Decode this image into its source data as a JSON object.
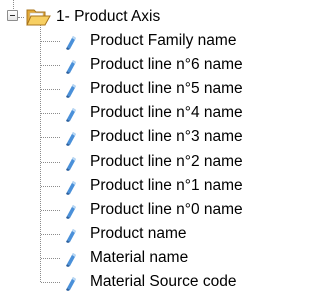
{
  "tree": {
    "root": {
      "label": "1- Product Axis",
      "icon": "folder-open-icon",
      "expanded": true
    },
    "children": [
      {
        "label": "Product Family name",
        "icon": "leaf-icon"
      },
      {
        "label": "Product line n°6 name",
        "icon": "leaf-icon"
      },
      {
        "label": "Product line n°5 name",
        "icon": "leaf-icon"
      },
      {
        "label": "Product line n°4 name",
        "icon": "leaf-icon"
      },
      {
        "label": "Product line n°3 name",
        "icon": "leaf-icon"
      },
      {
        "label": "Product line n°2 name",
        "icon": "leaf-icon"
      },
      {
        "label": "Product line n°1 name",
        "icon": "leaf-icon"
      },
      {
        "label": "Product line n°0 name",
        "icon": "leaf-icon"
      },
      {
        "label": "Product name",
        "icon": "leaf-icon"
      },
      {
        "label": "Material name",
        "icon": "leaf-icon"
      },
      {
        "label": "Material Source code",
        "icon": "leaf-icon"
      }
    ]
  },
  "colors": {
    "leaf_icon": "#4a90d9",
    "folder": "#e8b84a",
    "tree_line": "#8c8c8c"
  }
}
